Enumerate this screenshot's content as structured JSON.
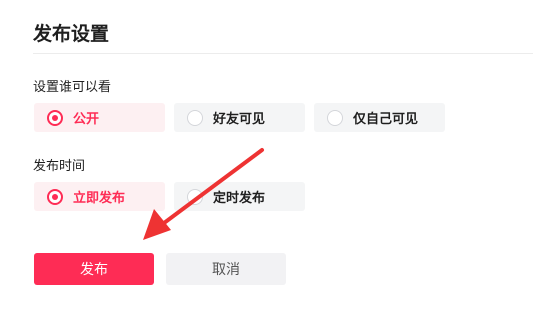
{
  "header": {
    "title": "发布设置"
  },
  "visibility": {
    "label": "设置谁可以看",
    "options": [
      {
        "label": "公开",
        "selected": true
      },
      {
        "label": "好友可见",
        "selected": false
      },
      {
        "label": "仅自己可见",
        "selected": false
      }
    ]
  },
  "publish_time": {
    "label": "发布时间",
    "options": [
      {
        "label": "立即发布",
        "selected": true
      },
      {
        "label": "定时发布",
        "selected": false
      }
    ]
  },
  "actions": {
    "publish_label": "发布",
    "cancel_label": "取消"
  },
  "colors": {
    "accent": "#fe2c55",
    "annotation_arrow": "#ee3333"
  }
}
